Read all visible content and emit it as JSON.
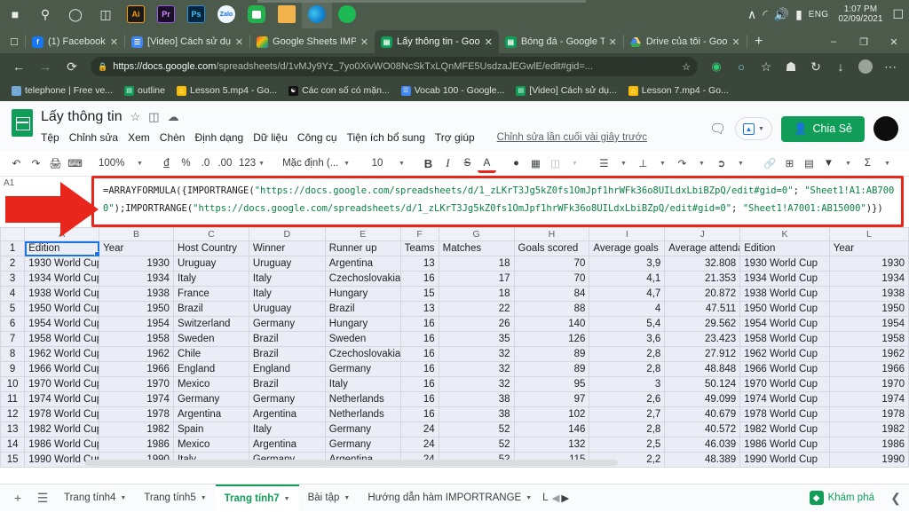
{
  "taskbar": {
    "icons": [
      "windows-start",
      "search",
      "cortana",
      "task-view",
      "Ai",
      "Pr",
      "Ps",
      "Zalo",
      "LINE",
      "file-explorer",
      "edge",
      "spotify"
    ],
    "lang": "ENG",
    "time": "1:07 PM",
    "date": "02/09/2021",
    "tray": [
      "chevron-up",
      "wifi",
      "volume",
      "battery"
    ]
  },
  "browser": {
    "tabs": [
      {
        "title": "(1) Facebook",
        "favicon": "facebook",
        "active": false
      },
      {
        "title": "[Video] Cách sử dụ",
        "favicon": "docs",
        "active": false
      },
      {
        "title": "Google Sheets IMP",
        "favicon": "chrome",
        "active": false
      },
      {
        "title": "Lấy thông tin - Goo",
        "favicon": "sheets",
        "active": true
      },
      {
        "title": "Bóng đá - Google T",
        "favicon": "sheets",
        "active": false
      },
      {
        "title": "Drive của tôi - Goo",
        "favicon": "drive",
        "active": false
      }
    ],
    "new_tab": "+",
    "window_controls": [
      "minimize",
      "restore",
      "close"
    ],
    "url_domain": "https://docs.google.com",
    "url_rest": "/spreadsheets/d/1vMJy9Yz_7yo0XivWO08NcSkTxLQnMFE5UsdzaJEGwlE/edit#gid=...",
    "nav_icons": [
      "back",
      "forward",
      "reload"
    ],
    "omnibox_icons": [
      "lock",
      "favorite-add"
    ],
    "toolbar_icons": [
      "extension-green",
      "extension-blue",
      "collections",
      "add-favorite",
      "history",
      "downloads",
      "profile",
      "more"
    ],
    "bookmarks": [
      {
        "label": "telephone | Free ve...",
        "icon": "link"
      },
      {
        "label": "outline",
        "icon": "sheets"
      },
      {
        "label": "Lesson 5.mp4 - Go...",
        "icon": "drive"
      },
      {
        "label": "Các con số có mặn...",
        "icon": "yinyang"
      },
      {
        "label": "Vocab 100 - Google...",
        "icon": "docs"
      },
      {
        "label": "[Video] Cách sử dụ...",
        "icon": "sheets"
      },
      {
        "label": "Lesson 7.mp4 - Go...",
        "icon": "drive"
      }
    ]
  },
  "sheets": {
    "doc_title": "Lấy thông tin",
    "title_icons": [
      "star-icon",
      "move-folder-icon",
      "cloud-saved-icon"
    ],
    "menus": [
      "Tệp",
      "Chỉnh sửa",
      "Xem",
      "Chèn",
      "Định dạng",
      "Dữ liệu",
      "Công cụ",
      "Tiện ích bổ sung",
      "Trợ giúp"
    ],
    "last_edit": "Chỉnh sửa lần cuối vài giây trước",
    "comment_icon": "comment-icon",
    "lock_label": "",
    "share_label": "Chia Sẻ",
    "toolbar": {
      "undo": "↶",
      "redo": "↷",
      "print": "print-icon",
      "paint": "paint-format-icon",
      "zoom": "100%",
      "currency": "đ",
      "percent": "%",
      "dec_dec": ".0",
      "dec_inc": ".00",
      "formats": "123",
      "font": "Mặc định (...",
      "font_size": "10",
      "bold": "B",
      "italic": "I",
      "strike": "S",
      "text_color": "A",
      "fill": "fill-color-icon",
      "borders": "borders-icon",
      "merge": "merge-cells-icon",
      "h_align": "horizontal-align-icon",
      "v_align": "vertical-align-icon",
      "wrap": "text-wrap-icon",
      "rotate": "text-rotation-icon",
      "link": "insert-link-icon",
      "comment": "insert-comment-icon",
      "chart": "insert-chart-icon",
      "filter": "filter-icon",
      "functions": "Σ",
      "input_tools": "ê",
      "collapse": "collapse-toolbar-icon"
    },
    "name_box": "A1",
    "formula": "=ARRAYFORMULA({IMPORTRANGE(\"https://docs.google.com/spreadsheets/d/1_zLKrT3Jg5kZ0fs1OmJpf1hrWFk36o8UILdxLbiBZpQ/edit#gid=0\"; \"Sheet1!A1:AB7000\");IMPORTRANGE(\"https://docs.google.com/spreadsheets/d/1_zLKrT3Jg5kZ0fs1OmJpf1hrWFk36o8UILdxLbiBZpQ/edit#gid=0\"; \"Sheet1!A7001:AB15000\")})",
    "formula_parts": [
      {
        "t": "=ARRAYFORMULA({IMPORTRANGE(",
        "s": false
      },
      {
        "t": "\"https://docs.google.com/spreadsheets/d/1_zLKrT3Jg5kZ0fs1OmJpf1hrWFk36o8UILdxLbiBZpQ/edit#gid=0\"",
        "s": true
      },
      {
        "t": "; ",
        "s": false
      },
      {
        "t": "\"Sheet1!A1:AB7000\"",
        "s": true
      },
      {
        "t": ");IMPORTRANGE(",
        "s": false
      },
      {
        "t": "\"https://docs.google.com/spreadsheets/d/1_zLKrT3Jg5kZ0fs1OmJpf1hrWFk36o8UILdxLbiBZpQ/edit#gid=0\"",
        "s": true
      },
      {
        "t": "; ",
        "s": false
      },
      {
        "t": "\"Sheet1!A7001:AB15000\"",
        "s": true
      },
      {
        "t": ")})",
        "s": false
      }
    ],
    "sheet_tabs": [
      {
        "label": "Trang tính4",
        "active": false
      },
      {
        "label": "Trang tính5",
        "active": false
      },
      {
        "label": "Trang tính7",
        "active": true
      },
      {
        "label": "Bài tập",
        "active": false
      },
      {
        "label": "Hướng dẫn hàm IMPORTRANGE",
        "active": false
      },
      {
        "label": "L",
        "active": false
      }
    ],
    "add_sheet_icon": "add-sheet-icon",
    "all_sheets_icon": "all-sheets-icon",
    "explore_label": "Khám phá",
    "accent_green": "#0f9d58",
    "accent_blue": "#1a73e8",
    "annotation_color": "#e8261b"
  },
  "grid": {
    "columns": [
      "A",
      "B",
      "C",
      "D",
      "E",
      "F",
      "G",
      "H",
      "I",
      "J",
      "K",
      "L"
    ],
    "headers": [
      "Edition",
      "Year",
      "Host Country",
      "Winner",
      "Runner up",
      "Teams",
      "Matches",
      "Goals scored",
      "Average goals",
      "Average attenda",
      "Edition",
      "Year"
    ],
    "rows": [
      {
        "n": 1,
        "cells": [
          "Edition",
          "Year",
          "Host Country",
          "Winner",
          "Runner up",
          "Teams",
          "Matches",
          "Goals scored",
          "Average goals",
          "Average attenda",
          "Edition",
          "Year"
        ]
      },
      {
        "n": 2,
        "cells": [
          "1930 World Cup",
          "1930",
          "Uruguay",
          "Uruguay",
          "Argentina",
          "13",
          "18",
          "70",
          "3,9",
          "32.808",
          "1930 World Cup",
          "1930"
        ]
      },
      {
        "n": 3,
        "cells": [
          "1934 World Cup",
          "1934",
          "Italy",
          "Italy",
          "Czechoslovakia",
          "16",
          "17",
          "70",
          "4,1",
          "21.353",
          "1934 World Cup",
          "1934"
        ]
      },
      {
        "n": 4,
        "cells": [
          "1938 World Cup",
          "1938",
          "France",
          "Italy",
          "Hungary",
          "15",
          "18",
          "84",
          "4,7",
          "20.872",
          "1938 World Cup",
          "1938"
        ]
      },
      {
        "n": 5,
        "cells": [
          "1950 World Cup",
          "1950",
          "Brazil",
          "Uruguay",
          "Brazil",
          "13",
          "22",
          "88",
          "4",
          "47.511",
          "1950 World Cup",
          "1950"
        ]
      },
      {
        "n": 6,
        "cells": [
          "1954 World Cup",
          "1954",
          "Switzerland",
          "Germany",
          "Hungary",
          "16",
          "26",
          "140",
          "5,4",
          "29.562",
          "1954 World Cup",
          "1954"
        ]
      },
      {
        "n": 7,
        "cells": [
          "1958 World Cup",
          "1958",
          "Sweden",
          "Brazil",
          "Sweden",
          "16",
          "35",
          "126",
          "3,6",
          "23.423",
          "1958 World Cup",
          "1958"
        ]
      },
      {
        "n": 8,
        "cells": [
          "1962 World Cup",
          "1962",
          "Chile",
          "Brazil",
          "Czechoslovakia",
          "16",
          "32",
          "89",
          "2,8",
          "27.912",
          "1962 World Cup",
          "1962"
        ]
      },
      {
        "n": 9,
        "cells": [
          "1966 World Cup",
          "1966",
          "England",
          "England",
          "Germany",
          "16",
          "32",
          "89",
          "2,8",
          "48.848",
          "1966 World Cup",
          "1966"
        ]
      },
      {
        "n": 10,
        "cells": [
          "1970 World Cup",
          "1970",
          "Mexico",
          "Brazil",
          "Italy",
          "16",
          "32",
          "95",
          "3",
          "50.124",
          "1970 World Cup",
          "1970"
        ]
      },
      {
        "n": 11,
        "cells": [
          "1974 World Cup",
          "1974",
          "Germany",
          "Germany",
          "Netherlands",
          "16",
          "38",
          "97",
          "2,6",
          "49.099",
          "1974 World Cup",
          "1974"
        ]
      },
      {
        "n": 12,
        "cells": [
          "1978 World Cup",
          "1978",
          "Argentina",
          "Argentina",
          "Netherlands",
          "16",
          "38",
          "102",
          "2,7",
          "40.679",
          "1978 World Cup",
          "1978"
        ]
      },
      {
        "n": 13,
        "cells": [
          "1982 World Cup",
          "1982",
          "Spain",
          "Italy",
          "Germany",
          "24",
          "52",
          "146",
          "2,8",
          "40.572",
          "1982 World Cup",
          "1982"
        ]
      },
      {
        "n": 14,
        "cells": [
          "1986 World Cup",
          "1986",
          "Mexico",
          "Argentina",
          "Germany",
          "24",
          "52",
          "132",
          "2,5",
          "46.039",
          "1986 World Cup",
          "1986"
        ]
      },
      {
        "n": 15,
        "cells": [
          "1990 World Cup",
          "1990",
          "Italy",
          "Germany",
          "Argentina",
          "24",
          "52",
          "115",
          "2,2",
          "48.389",
          "1990 World Cup",
          "1990"
        ]
      }
    ],
    "numeric_columns": [
      1,
      5,
      6,
      7,
      8,
      9,
      11
    ],
    "selected_cell": "A1"
  }
}
